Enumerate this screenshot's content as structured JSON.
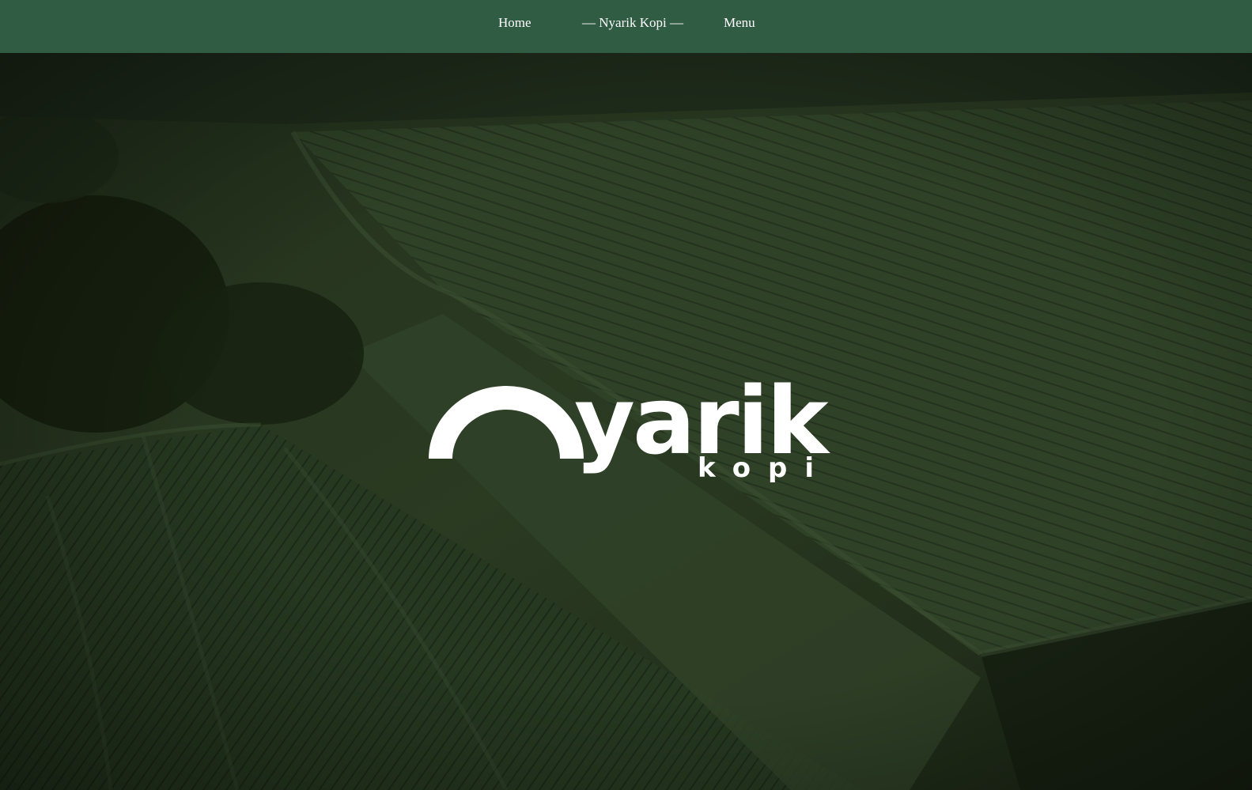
{
  "nav": {
    "home_label": "Home",
    "brand_label": "— Nyarik Kopi —",
    "menu_label": "Menu"
  },
  "hero": {
    "logo_word": "yarik",
    "logo_sub": "kopi"
  },
  "colors": {
    "nav_background": "#305c44",
    "text": "#ffffff",
    "hero_overlay": "#1e2b18"
  }
}
